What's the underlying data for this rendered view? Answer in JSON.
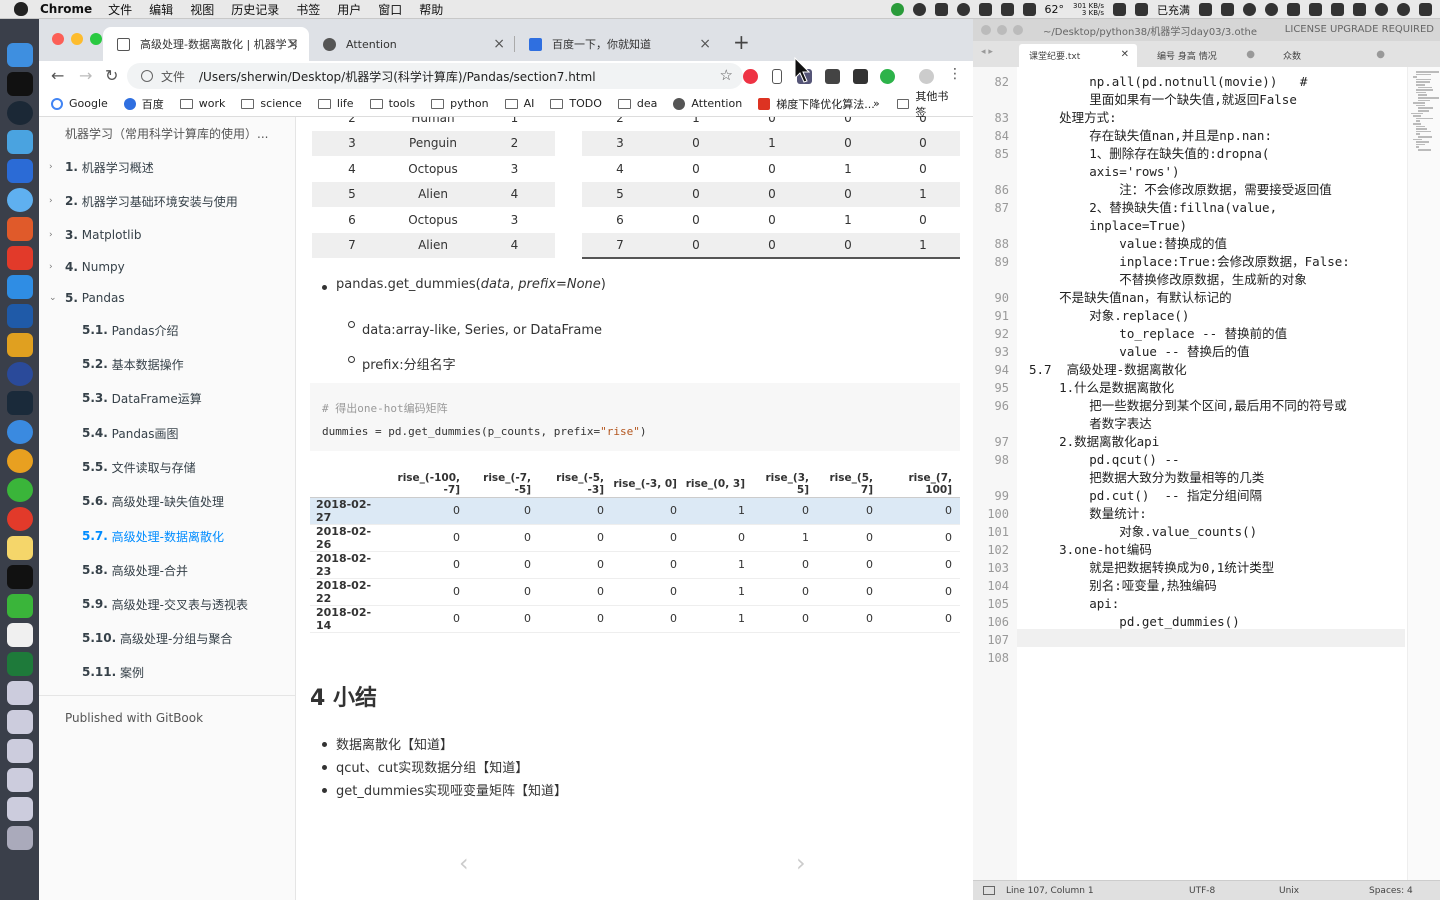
{
  "menubar": {
    "app": "Chrome",
    "items": [
      "文件",
      "编辑",
      "视图",
      "历史记录",
      "书签",
      "用户",
      "窗口",
      "帮助"
    ],
    "temperature": "62°",
    "net_up": "301 KB/s",
    "net_down": "3 KB/s",
    "battery": "已充满"
  },
  "chrome": {
    "tabs": [
      {
        "title": "高级处理-数据离散化 | 机器学习"
      },
      {
        "title": "Attention"
      },
      {
        "title": "百度一下，你就知道"
      }
    ],
    "address_label": "文件",
    "url": "/Users/sherwin/Desktop/机器学习(科学计算库)/Pandas/section7.html",
    "bookmarks": [
      "Google",
      "百度",
      "work",
      "science",
      "life",
      "tools",
      "python",
      "AI",
      "TODO",
      "dea",
      "Attention",
      "梯度下降优化算法..."
    ],
    "bookmarks_more": "»",
    "other_bookmarks": "其他书签"
  },
  "sidebar": {
    "header": "机器学习（常用科学计算库的使用）...",
    "items": [
      {
        "num": "1.",
        "label": "机器学习概述"
      },
      {
        "num": "2.",
        "label": "机器学习基础环境安装与使用"
      },
      {
        "num": "3.",
        "label": "Matplotlib"
      },
      {
        "num": "4.",
        "label": "Numpy"
      },
      {
        "num": "5.",
        "label": "Pandas"
      }
    ],
    "subitems": [
      {
        "num": "5.1.",
        "label": "Pandas介绍"
      },
      {
        "num": "5.2.",
        "label": "基本数据操作"
      },
      {
        "num": "5.3.",
        "label": "DataFrame运算"
      },
      {
        "num": "5.4.",
        "label": "Pandas画图"
      },
      {
        "num": "5.5.",
        "label": "文件读取与存储"
      },
      {
        "num": "5.6.",
        "label": "高级处理-缺失值处理"
      },
      {
        "num": "5.7.",
        "label": "高级处理-数据离散化"
      },
      {
        "num": "5.8.",
        "label": "高级处理-合并"
      },
      {
        "num": "5.9.",
        "label": "高级处理-交叉表与透视表"
      },
      {
        "num": "5.10.",
        "label": "高级处理-分组与聚合"
      },
      {
        "num": "5.11.",
        "label": "案例"
      }
    ],
    "published": "Published with GitBook"
  },
  "content": {
    "left_table": [
      [
        "2",
        "Human",
        "1"
      ],
      [
        "3",
        "Penguin",
        "2"
      ],
      [
        "4",
        "Octopus",
        "3"
      ],
      [
        "5",
        "Alien",
        "4"
      ],
      [
        "6",
        "Octopus",
        "3"
      ],
      [
        "7",
        "Alien",
        "4"
      ]
    ],
    "right_table": [
      [
        "2",
        "1",
        "0",
        "0",
        "0"
      ],
      [
        "3",
        "0",
        "1",
        "0",
        "0"
      ],
      [
        "4",
        "0",
        "0",
        "1",
        "0"
      ],
      [
        "5",
        "0",
        "0",
        "0",
        "1"
      ],
      [
        "6",
        "0",
        "0",
        "1",
        "0"
      ],
      [
        "7",
        "0",
        "0",
        "0",
        "1"
      ]
    ],
    "func_prefix": "pandas.get_dummies(",
    "func_arg1": "data",
    "func_sep": ", ",
    "func_arg2": "prefix=None",
    "func_suffix": ")",
    "params": [
      "data:array-like, Series, or DataFrame",
      "prefix:分组名字"
    ],
    "code_comment": "# 得出one-hot编码矩阵",
    "code_line_a": "dummies = pd.get_dummies(p_counts, prefix=",
    "code_line_str": "\"rise\"",
    "code_line_b": ")",
    "dummies_columns": [
      "rise_(-100, -7]",
      "rise_(-7, -5]",
      "rise_(-5, -3]",
      "rise_(-3, 0]",
      "rise_(0, 3]",
      "rise_(3, 5]",
      "rise_(5, 7]",
      "rise_(7, 100]"
    ],
    "dummies_rows": [
      {
        "idx": "2018-02-27",
        "vals": [
          "0",
          "0",
          "0",
          "0",
          "1",
          "0",
          "0",
          "0"
        ]
      },
      {
        "idx": "2018-02-26",
        "vals": [
          "0",
          "0",
          "0",
          "0",
          "0",
          "1",
          "0",
          "0"
        ]
      },
      {
        "idx": "2018-02-23",
        "vals": [
          "0",
          "0",
          "0",
          "0",
          "1",
          "0",
          "0",
          "0"
        ]
      },
      {
        "idx": "2018-02-22",
        "vals": [
          "0",
          "0",
          "0",
          "0",
          "1",
          "0",
          "0",
          "0"
        ]
      },
      {
        "idx": "2018-02-14",
        "vals": [
          "0",
          "0",
          "0",
          "0",
          "1",
          "0",
          "0",
          "0"
        ]
      }
    ],
    "summary_title": "4 小结",
    "summary": [
      "数据离散化【知道】",
      "qcut、cut实现数据分组【知道】",
      "get_dummies实现哑变量矩阵【知道】"
    ],
    "prev_arrow": "‹",
    "next_arrow": "›"
  },
  "editor": {
    "title_path": "~/Desktop/python38/机器学习day03/3.othe",
    "license": "LICENSE UPGRADE REQUIRED",
    "tabs": [
      "课堂纪要.txt",
      "编号  身高  情况",
      "众数"
    ],
    "lines": [
      {
        "n": "82",
        "t": "        np.all(pd.notnull(movie))   #"
      },
      {
        "n": "",
        "t": "        里面如果有一个缺失值,就返回False"
      },
      {
        "n": "83",
        "t": "    处理方式:"
      },
      {
        "n": "84",
        "t": "        存在缺失值nan,并且是np.nan:"
      },
      {
        "n": "85",
        "t": "        1、删除存在缺失值的:dropna("
      },
      {
        "n": "",
        "t": "        axis='rows')"
      },
      {
        "n": "86",
        "t": "            注：不会修改原数据，需要接受返回值"
      },
      {
        "n": "87",
        "t": "        2、替换缺失值:fillna(value,"
      },
      {
        "n": "",
        "t": "        inplace=True)"
      },
      {
        "n": "88",
        "t": "            value:替换成的值"
      },
      {
        "n": "89",
        "t": "            inplace:True:会修改原数据，False:"
      },
      {
        "n": "",
        "t": "            不替换修改原数据，生成新的对象"
      },
      {
        "n": "90",
        "t": "    不是缺失值nan，有默认标记的"
      },
      {
        "n": "91",
        "t": "        对象.replace()"
      },
      {
        "n": "92",
        "t": "            to_replace -- 替换前的值"
      },
      {
        "n": "93",
        "t": "            value -- 替换后的值"
      },
      {
        "n": "94",
        "t": "5.7  高级处理-数据离散化"
      },
      {
        "n": "95",
        "t": "    1.什么是数据离散化"
      },
      {
        "n": "96",
        "t": "        把一些数据分到某个区间,最后用不同的符号或"
      },
      {
        "n": "",
        "t": "        者数字表达"
      },
      {
        "n": "97",
        "t": "    2.数据离散化api"
      },
      {
        "n": "98",
        "t": "        pd.qcut() --"
      },
      {
        "n": "",
        "t": "        把数据大致分为数量相等的几类"
      },
      {
        "n": "99",
        "t": "        pd.cut()  -- 指定分组间隔"
      },
      {
        "n": "100",
        "t": "        数量统计:"
      },
      {
        "n": "101",
        "t": "            对象.value_counts()"
      },
      {
        "n": "102",
        "t": "    3.one-hot编码"
      },
      {
        "n": "103",
        "t": "        就是把数据转换成为0,1统计类型"
      },
      {
        "n": "104",
        "t": "        别名:哑变量,热独编码"
      },
      {
        "n": "105",
        "t": "        api:"
      },
      {
        "n": "106",
        "t": "            pd.get_dummies()"
      },
      {
        "n": "107",
        "t": ""
      },
      {
        "n": "108",
        "t": ""
      }
    ],
    "status": {
      "pos": "Line 107, Column 1",
      "enc": "UTF-8",
      "eol": "Unix",
      "indent": "Spaces: 4"
    }
  }
}
